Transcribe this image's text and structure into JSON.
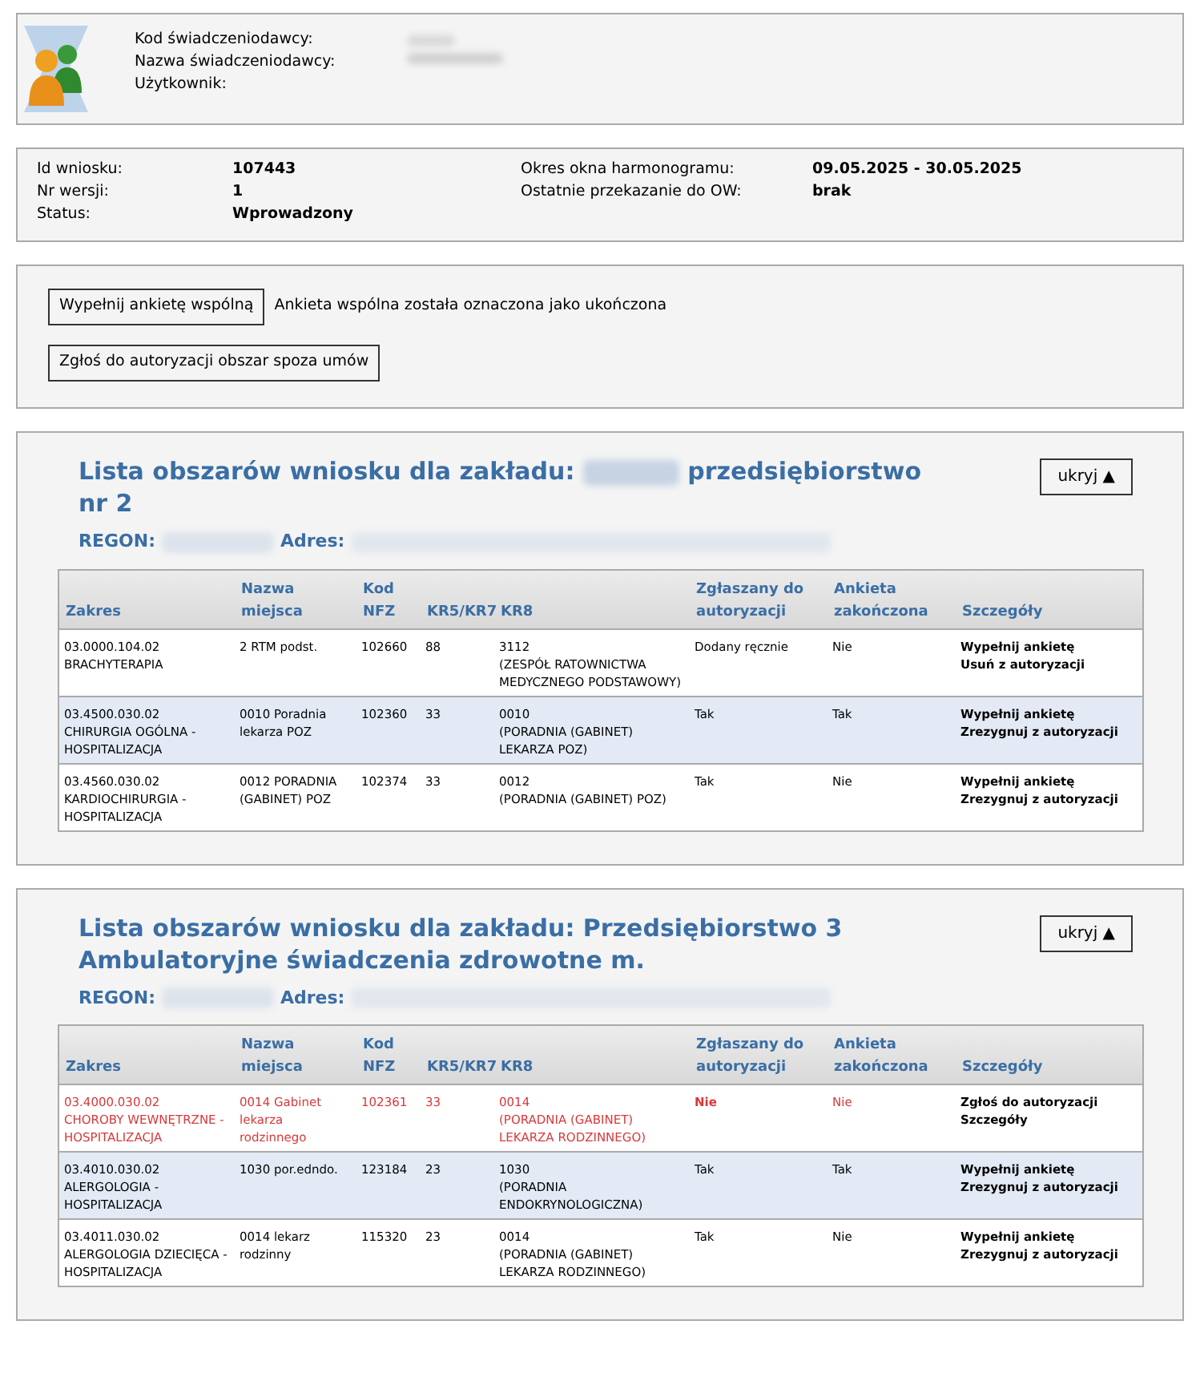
{
  "provider": {
    "labels": [
      "Kod świadczeniodawcy:",
      "Nazwa świadczeniodawcy:",
      "Użytkownik:"
    ]
  },
  "request": {
    "left": [
      {
        "label": "Id wniosku:",
        "value": "107443"
      },
      {
        "label": "Nr wersji:",
        "value": "1"
      },
      {
        "label": "Status:",
        "value": "Wprowadzony"
      }
    ],
    "right": [
      {
        "label": "Okres okna harmonogramu:",
        "value": "09.05.2025 - 30.05.2025"
      },
      {
        "label": "Ostatnie przekazanie do OW:",
        "value": "brak"
      }
    ]
  },
  "actions": {
    "survey_button": "Wypełnij ankietę wspólną",
    "survey_note": "Ankieta wspólna została oznaczona jako ukończona",
    "report_button": "Zgłoś do autoryzacji obszar spoza umów"
  },
  "sections": [
    {
      "title": "Lista obszarów wniosku dla zakładu:",
      "title_after_redaction": "przedsiębiorstwo nr 2",
      "toggle": "ukryj ▲",
      "regon_label": "REGON:",
      "address_label": "Adres:",
      "columns": [
        "Zakres",
        "Nazwa miejsca",
        "Kod NFZ",
        "KR5/KR7",
        "KR8",
        "Zgłaszany do autoryzacji",
        "Ankieta zakończona",
        "Szczegóły"
      ],
      "rows": [
        {
          "flagged": false,
          "zakres_code": "03.0000.104.02",
          "zakres_name": "BRACHYTERAPIA",
          "place": "2 RTM podst.",
          "nfz": "102660",
          "kr5": "88",
          "kr8_code": "3112",
          "kr8_name": "(ZESPÓŁ RATOWNICTWA MEDYCZNEGO PODSTAWOWY)",
          "reported": "Dodany ręcznie",
          "survey_done": "Nie",
          "links": [
            "Wypełnij ankietę",
            "Usuń z autoryzacji"
          ]
        },
        {
          "flagged": false,
          "zakres_code": "03.4500.030.02",
          "zakres_name": "CHIRURGIA OGÓLNA - HOSPITALIZACJA",
          "place": "0010 Poradnia lekarza POZ",
          "nfz": "102360",
          "kr5": "33",
          "kr8_code": "0010",
          "kr8_name": "(PORADNIA (GABINET) LEKARZA POZ)",
          "reported": "Tak",
          "survey_done": "Tak",
          "links": [
            "Wypełnij ankietę",
            "Zrezygnuj z autoryzacji"
          ]
        },
        {
          "flagged": false,
          "zakres_code": "03.4560.030.02",
          "zakres_name": "KARDIOCHIRURGIA - HOSPITALIZACJA",
          "place": "0012 PORADNIA (GABINET) POZ",
          "nfz": "102374",
          "kr5": "33",
          "kr8_code": "0012",
          "kr8_name": "(PORADNIA (GABINET) POZ)",
          "reported": "Tak",
          "survey_done": "Nie",
          "links": [
            "Wypełnij ankietę",
            "Zrezygnuj z autoryzacji"
          ]
        }
      ]
    },
    {
      "title": "Lista obszarów wniosku dla zakładu: Przedsiębiorstwo 3 Ambulatoryjne świadczenia zdrowotne m.",
      "toggle": "ukryj ▲",
      "regon_label": "REGON:",
      "address_label": "Adres:",
      "columns": [
        "Zakres",
        "Nazwa miejsca",
        "Kod NFZ",
        "KR5/KR7",
        "KR8",
        "Zgłaszany do autoryzacji",
        "Ankieta zakończona",
        "Szczegóły"
      ],
      "rows": [
        {
          "flagged": true,
          "zakres_code": "03.4000.030.02",
          "zakres_name": "CHOROBY WEWNĘTRZNE - HOSPITALIZACJA",
          "place": "0014 Gabinet lekarza rodzinnego",
          "nfz": "102361",
          "kr5": "33",
          "kr8_code": "0014",
          "kr8_name": "(PORADNIA (GABINET) LEKARZA RODZINNEGO)",
          "reported": "Nie",
          "survey_done": "Nie",
          "links": [
            "Zgłoś do autoryzacji",
            "Szczegóły"
          ]
        },
        {
          "flagged": false,
          "zakres_code": "03.4010.030.02",
          "zakres_name": "ALERGOLOGIA - HOSPITALIZACJA",
          "place": "1030 por.edndo.",
          "nfz": "123184",
          "kr5": "23",
          "kr8_code": "1030",
          "kr8_name": "(PORADNIA ENDOKRYNOLOGICZNA)",
          "reported": "Tak",
          "survey_done": "Tak",
          "links": [
            "Wypełnij ankietę",
            "Zrezygnuj z autoryzacji"
          ]
        },
        {
          "flagged": false,
          "zakres_code": "03.4011.030.02",
          "zakres_name": "ALERGOLOGIA DZIECIĘCA - HOSPITALIZACJA",
          "place": "0014 lekarz rodzinny",
          "nfz": "115320",
          "kr5": "23",
          "kr8_code": "0014",
          "kr8_name": "(PORADNIA (GABINET) LEKARZA RODZINNEGO)",
          "reported": "Tak",
          "survey_done": "Nie",
          "links": [
            "Wypełnij ankietę",
            "Zrezygnuj z autoryzacji"
          ]
        }
      ]
    }
  ]
}
